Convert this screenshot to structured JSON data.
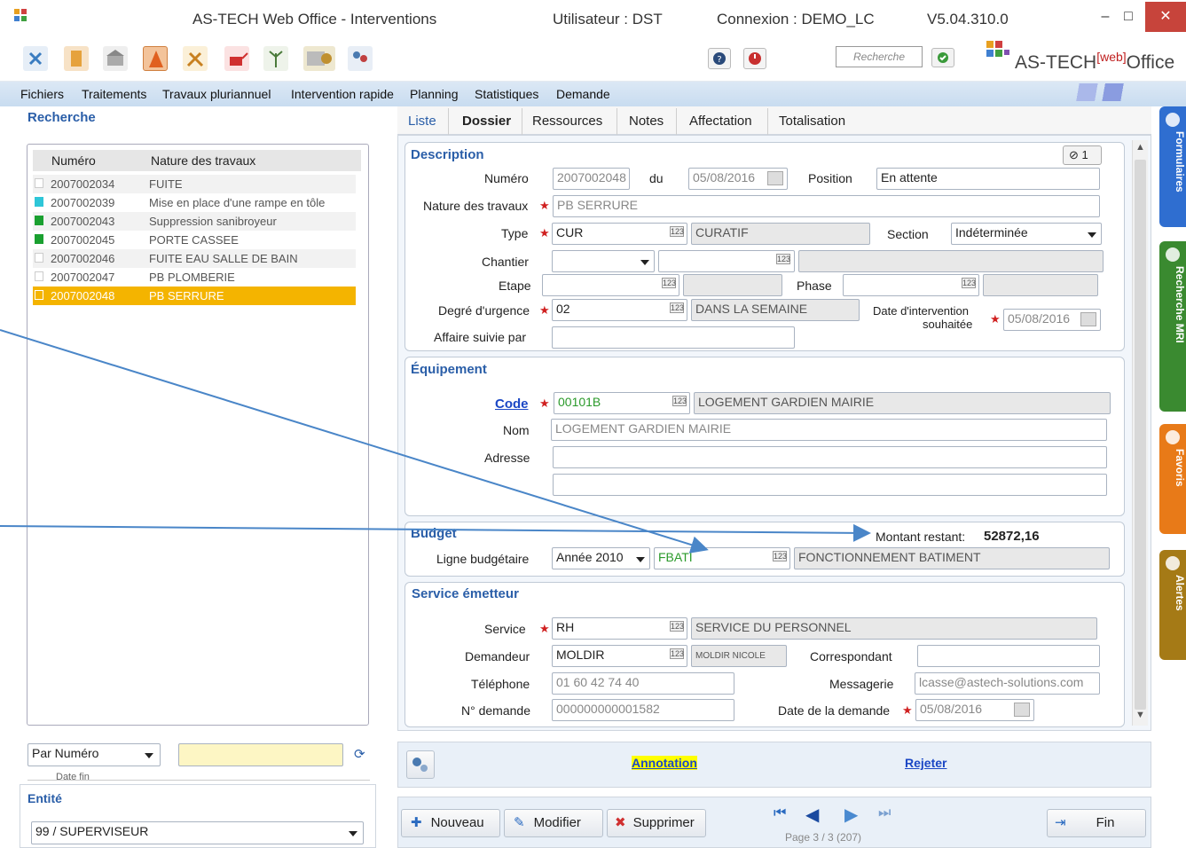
{
  "title_bar": {
    "app_title": "AS-TECH Web Office - Interventions",
    "user": "Utilisateur : DST",
    "connection": "Connexion : DEMO_LC",
    "version": "V5.04.310.0"
  },
  "toolbar": {
    "search_placeholder": "Recherche",
    "brand": "AS-TECH",
    "brand_super": "[web]",
    "brand_suffix": "Office"
  },
  "menu": [
    "Fichiers",
    "Traitements",
    "Travaux pluriannuel",
    "Intervention rapide",
    "Planning",
    "Statistiques",
    "Demande"
  ],
  "left": {
    "search_title": "Recherche",
    "columns": [
      "Numéro",
      "Nature des travaux"
    ],
    "rows": [
      {
        "num": "2007002034",
        "nature": "FUITE",
        "status": "none"
      },
      {
        "num": "2007002039",
        "nature": "Mise en place d'une rampe en tôle",
        "status": "cyan"
      },
      {
        "num": "2007002043",
        "nature": "Suppression sanibroyeur",
        "status": "green"
      },
      {
        "num": "2007002045",
        "nature": "PORTE CASSEE",
        "status": "green"
      },
      {
        "num": "2007002046",
        "nature": "FUITE EAU SALLE DE BAIN",
        "status": "none"
      },
      {
        "num": "2007002047",
        "nature": "PB PLOMBERIE",
        "status": "none"
      },
      {
        "num": "2007002048",
        "nature": "PB SERRURE",
        "status": "selected"
      }
    ],
    "sort_select": "Par Numéro",
    "date_fin_label": "Date fin",
    "entity_title": "Entité",
    "entity_value": "99 / SUPERVISEUR"
  },
  "tabs": [
    "Liste",
    "Dossier",
    "Ressources",
    "Notes",
    "Affectation",
    "Totalisation"
  ],
  "active_tab": "Dossier",
  "description": {
    "title": "Description",
    "attach_count": "1",
    "numero_label": "Numéro",
    "numero": "2007002048",
    "du_label": "du",
    "date": "05/08/2016",
    "position_label": "Position",
    "position": "En attente",
    "nature_label": "Nature des travaux",
    "nature": "PB SERRURE",
    "type_label": "Type",
    "type_code": "CUR",
    "type_desc": "CURATIF",
    "section_label": "Section",
    "section": "Indéterminée",
    "chantier_label": "Chantier",
    "etape_label": "Etape",
    "phase_label": "Phase",
    "urgence_label": "Degré d'urgence",
    "urgence_code": "02",
    "urgence_desc": "DANS LA SEMAINE",
    "date_interv_label_1": "Date d'intervention",
    "date_interv_label_2": "souhaitée",
    "date_interv": "05/08/2016",
    "affaire_label": "Affaire suivie par"
  },
  "equipement": {
    "title": "Équipement",
    "code_label": "Code",
    "code": "00101B",
    "code_desc": "LOGEMENT GARDIEN MAIRIE",
    "nom_label": "Nom",
    "nom": "LOGEMENT GARDIEN MAIRIE",
    "adresse_label": "Adresse"
  },
  "budget": {
    "title": "Budget",
    "montant_label": "Montant restant:",
    "montant": "52872,16",
    "ligne_label": "Ligne budgétaire",
    "annee": "Année 2010",
    "code": "FBATI",
    "desc": "FONCTIONNEMENT BATIMENT"
  },
  "service": {
    "title": "Service émetteur",
    "service_label": "Service",
    "service_code": "RH",
    "service_desc": "SERVICE DU PERSONNEL",
    "demandeur_label": "Demandeur",
    "demandeur_code": "MOLDIR",
    "demandeur_desc": "MOLDIR NICOLE",
    "correspondant_label": "Correspondant",
    "telephone_label": "Téléphone",
    "telephone": "01 60 42 74 40",
    "messagerie_label": "Messagerie",
    "messagerie": "lcasse@astech-solutions.com",
    "ndemande_label": "N° demande",
    "ndemande": "000000000001582",
    "date_demande_label": "Date de la demande",
    "date_demande": "05/08/2016"
  },
  "side_tabs": [
    "Formulaires",
    "Recherche MRI",
    "Favoris",
    "Alertes"
  ],
  "annotation": {
    "annotation_link": "Annotation",
    "reject_link": "Rejeter"
  },
  "actions": {
    "nouveau": "Nouveau",
    "modifier": "Modifier",
    "supprimer": "Supprimer",
    "fin": "Fin",
    "page_info": "Page 3 / 3 (207)"
  },
  "colors": {
    "accent": "#2a5ea8",
    "selected_row": "#f4b400",
    "close": "#c7443b",
    "arrow": "#4a86c8"
  }
}
